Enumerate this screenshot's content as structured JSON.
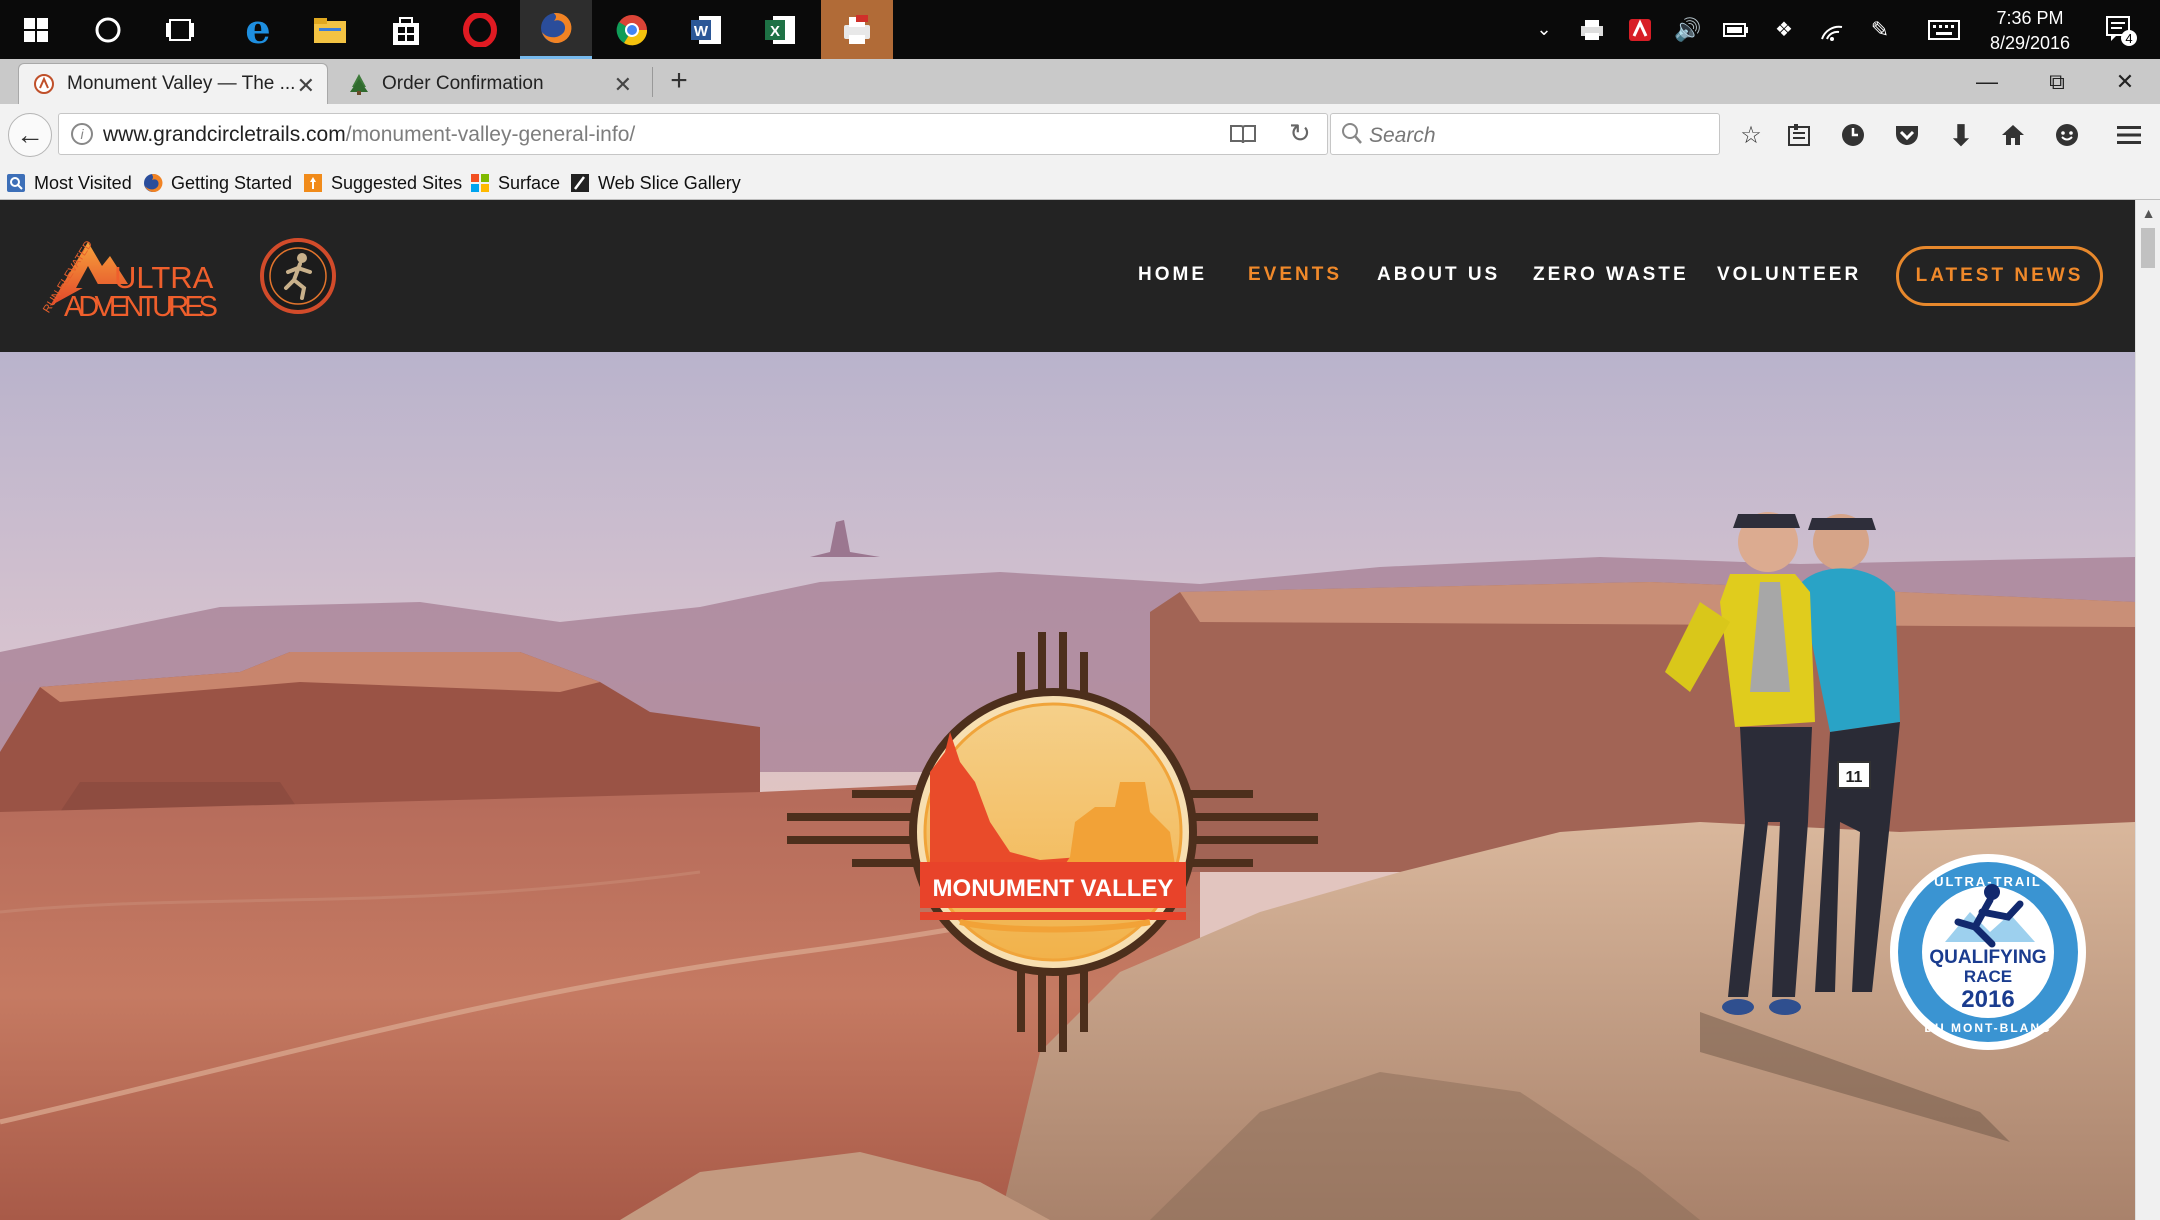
{
  "taskbar": {
    "clock_time": "7:36 PM",
    "clock_date": "8/29/2016",
    "notification_count": "4"
  },
  "browser": {
    "tabs": [
      {
        "title": "Monument Valley — The ..."
      },
      {
        "title": "Order Confirmation"
      }
    ],
    "url_host": "www.grandcircletrails.com",
    "url_path": "/monument-valley-general-info/",
    "search_placeholder": "Search",
    "bookmarks": [
      "Most Visited",
      "Getting Started",
      "Suggested Sites",
      "Surface",
      "Web Slice Gallery"
    ]
  },
  "site": {
    "logo_line1": "ULTRA",
    "logo_line2": "ADVENTURES",
    "logo_tagline": "RUN ELEVATED",
    "nav": [
      "HOME",
      "EVENTS",
      "ABOUT US",
      "ZERO WASTE",
      "VOLUNTEER"
    ],
    "cta": "LATEST NEWS",
    "accent_color": "#f0892a"
  },
  "hero": {
    "emblem_text": "MONUMENT VALLEY",
    "badge_top": "ULTRA-TRAIL",
    "badge_bottom": "DU MONT-BLANC",
    "badge_line1": "QUALIFYING",
    "badge_line2": "RACE",
    "badge_year": "2016",
    "bib_number": "11"
  }
}
